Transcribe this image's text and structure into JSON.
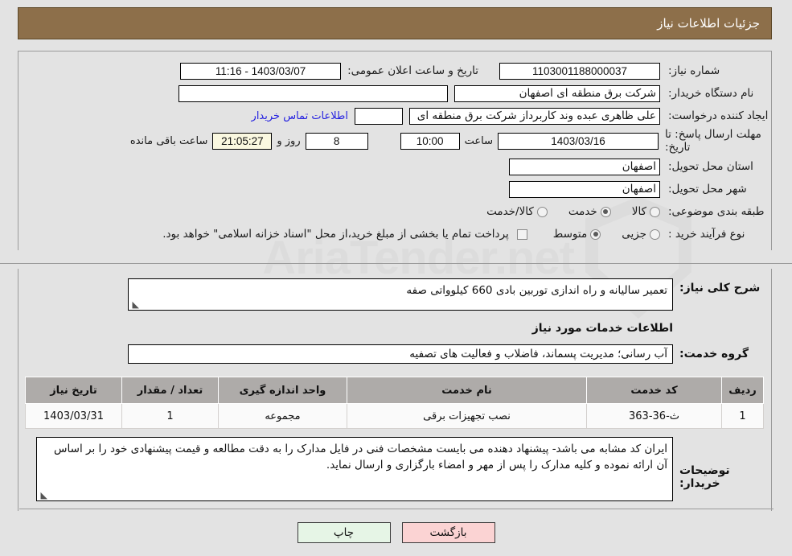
{
  "header": {
    "title": "جزئیات اطلاعات نیاز"
  },
  "form": {
    "need_number_label": "شماره نیاز:",
    "need_number_value": "1103001188000037",
    "public_announce_label": "تاریخ و ساعت اعلان عمومی:",
    "public_announce_value": "1403/03/07 - 11:16",
    "buyer_org_label": "نام دستگاه خریدار:",
    "buyer_org_value": "شرکت برق منطقه ای اصفهان",
    "blank_field_value": "",
    "creator_label": "ایجاد کننده درخواست:",
    "creator_value": "علی ظاهری عبده وند کاربرداز شرکت برق منطقه ای اصفهان",
    "buyer_contact_link": "اطلاعات تماس خریدار",
    "buyer_contact_value": "",
    "deadline_label": "مهلت ارسال پاسخ: تا تاریخ:",
    "deadline_date": "1403/03/16",
    "hour_label": "ساعت",
    "deadline_time": "10:00",
    "days_value": "8",
    "days_label": "روز و",
    "countdown_value": "21:05:27",
    "remaining_label": "ساعت باقی مانده",
    "province_label": "استان محل تحویل:",
    "province_value": "اصفهان",
    "city_label": "شهر محل تحویل:",
    "city_value": "اصفهان",
    "category_label": "طبقه بندی موضوعی:",
    "category_options": [
      {
        "label": "کالا",
        "selected": false
      },
      {
        "label": "خدمت",
        "selected": true
      },
      {
        "label": "کالا/خدمت",
        "selected": false
      }
    ],
    "process_label": "نوع فرآیند خرید :",
    "process_options": [
      {
        "label": "جزیی",
        "selected": false
      },
      {
        "label": "متوسط",
        "selected": true
      }
    ],
    "treasury_checkbox_checked": false,
    "treasury_text": "پرداخت تمام یا بخشی از مبلغ خرید،از محل \"اسناد خزانه اسلامی\" خواهد بود."
  },
  "description": {
    "label": "شرح کلی نیاز:",
    "value": "تعمیر سالیانه و راه اندازی توربین بادی 660 کیلوواتی صفه",
    "resize_grip": "◣"
  },
  "services_section": {
    "title": "اطلاعات خدمات مورد نیاز",
    "group_label": "گروه خدمت:",
    "group_value": "آب رسانی؛ مدیریت پسماند، فاضلاب و فعالیت های تصفیه"
  },
  "table": {
    "columns": [
      "ردیف",
      "کد خدمت",
      "نام خدمت",
      "واحد اندازه گیری",
      "تعداد / مقدار",
      "تاریخ نیاز"
    ],
    "rows": [
      {
        "row_no": "1",
        "service_code": "ث-36-363",
        "service_name": "نصب تجهیزات برقی",
        "unit": "مجموعه",
        "quantity": "1",
        "need_date": "1403/03/31"
      }
    ]
  },
  "buyer_notes": {
    "label": "توضیحات خریدار:",
    "value": "ایران کد مشابه می باشد- پیشنهاد دهنده می بایست مشخصات فنی در فایل مدارک  را به دقت مطالعه و قیمت پیشنهادی خود را بر اساس آن ارائه نموده و کلیه مدارک را پس از مهر و امضاء بارگزاری و ارسال نماید.",
    "resize_grip": "◣"
  },
  "footer": {
    "print_label": "چاپ",
    "back_label": "بازگشت"
  },
  "watermark": {
    "text": "AriaTender.net"
  },
  "colors": {
    "titlebar_bg": "#8d6f4a",
    "page_bg": "#e3e3e3",
    "link": "#2420e0",
    "table_header": "#aeaba9",
    "countdown_bg": "#faf8e0",
    "btn_print_bg": "#e6f5e6",
    "btn_back_bg": "#fbd3d3"
  }
}
